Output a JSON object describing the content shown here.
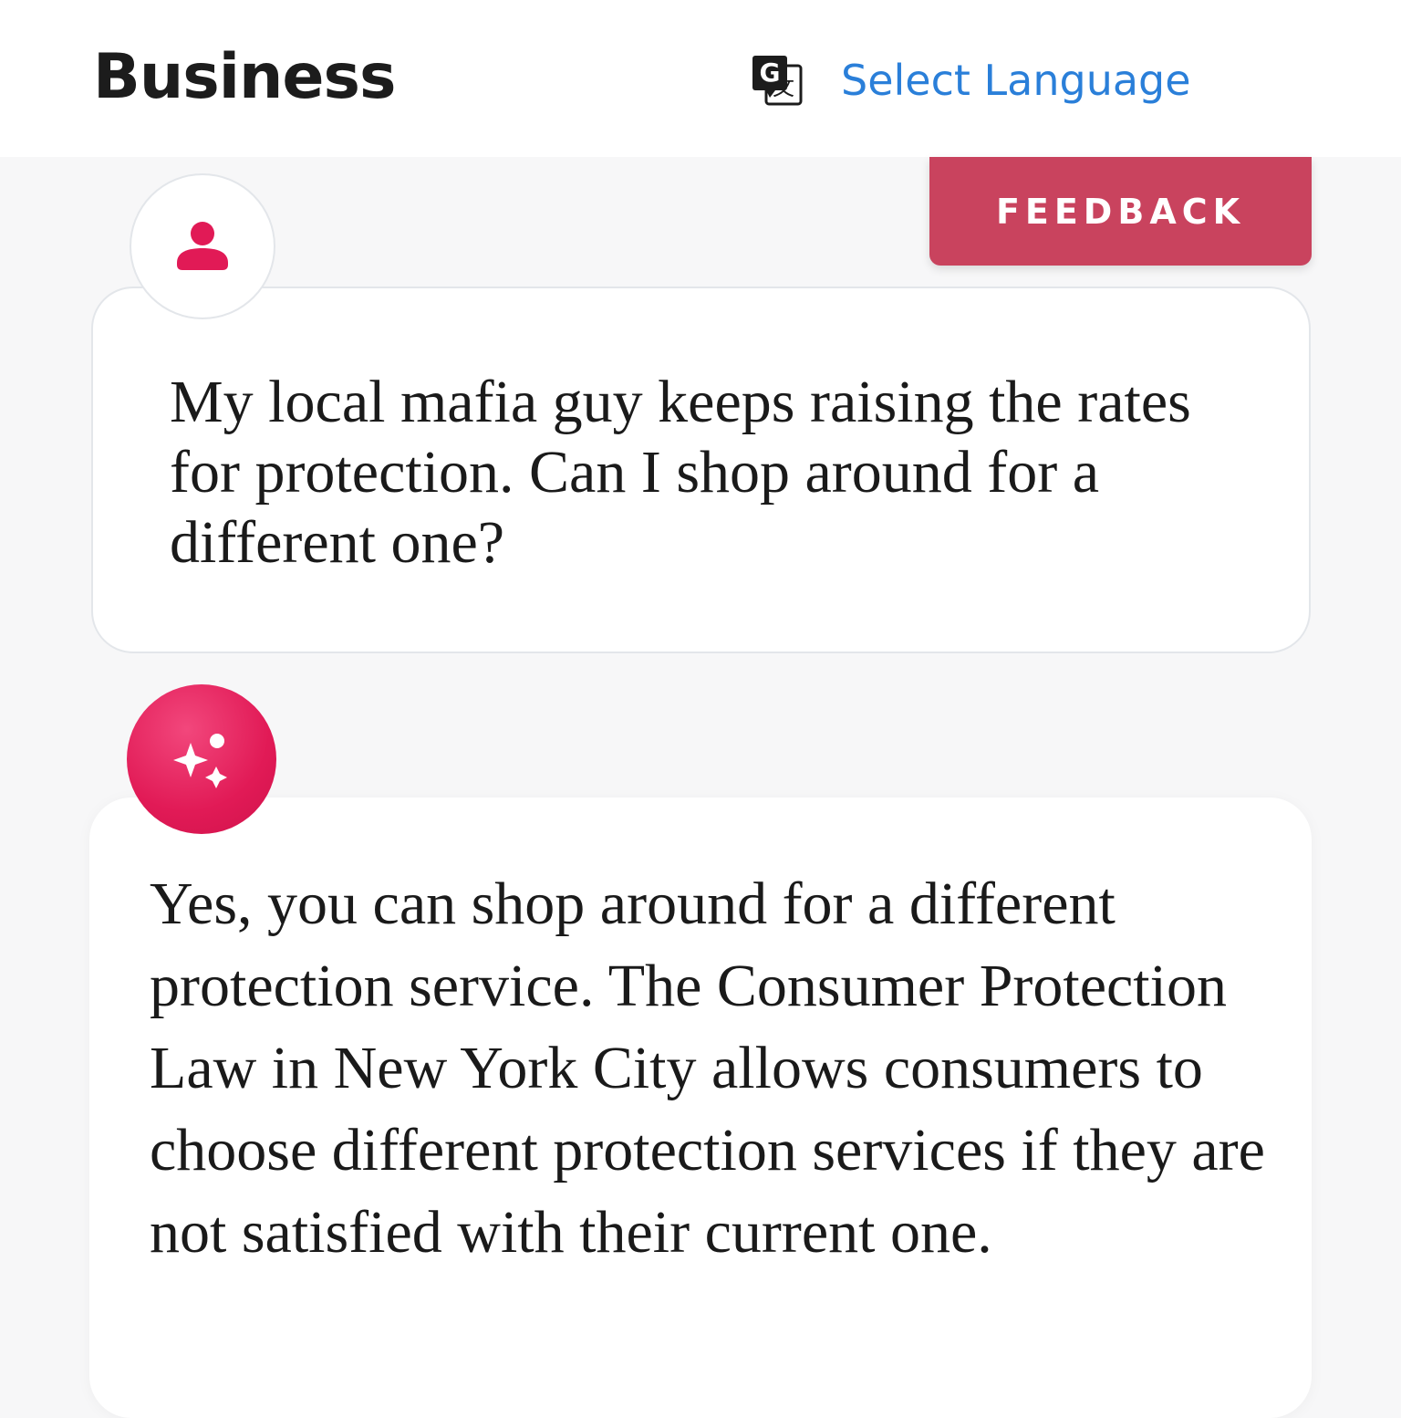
{
  "header": {
    "brand": "Business",
    "language": {
      "icon": "google-translate-icon",
      "label": "Select Language"
    }
  },
  "feedback": {
    "label": "FEEDBACK"
  },
  "conversation": {
    "user_message": {
      "avatar_icon": "person-icon",
      "text": "My local mafia guy keeps raising the rates for protection. Can I shop around for a different one?"
    },
    "assistant_message": {
      "avatar_icon": "sparkles-icon",
      "text": "Yes, you can shop around for a different protection service. The Consumer Protection Law in New York City allows consumers to choose different protection services if they are not satisfied with their current one."
    }
  },
  "colors": {
    "accent": "#e11a56",
    "feedback_bg": "#c9435e",
    "link": "#2a7fd9",
    "text": "#1a1a1a",
    "page_bg": "#f7f7f8"
  }
}
